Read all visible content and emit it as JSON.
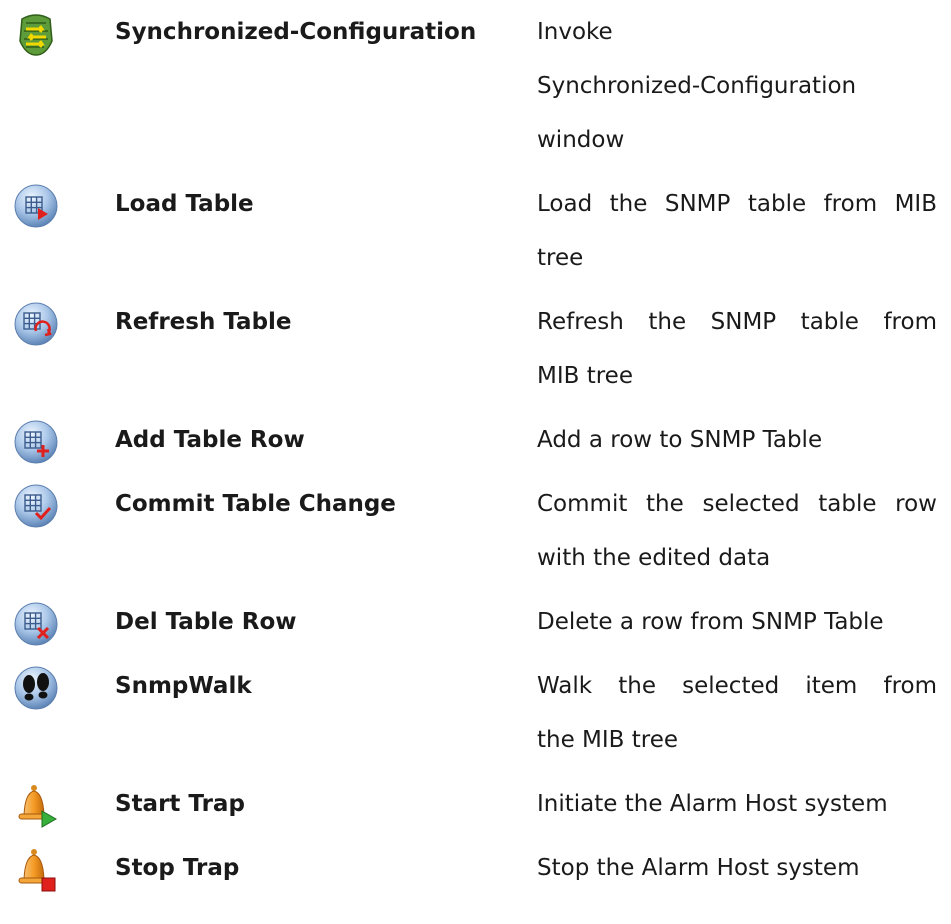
{
  "rows": [
    {
      "icon": "sync-config-icon",
      "name": "Synchronized-Configuration",
      "desc_lines": [
        "Invoke",
        "Synchronized-Configuration",
        "window"
      ]
    },
    {
      "icon": "load-table-icon",
      "name": "Load Table",
      "desc_lines": [
        "Load the SNMP table from MIB",
        "tree"
      ]
    },
    {
      "icon": "refresh-table-icon",
      "name": "Refresh Table",
      "desc_lines": [
        "Refresh the SNMP table from",
        "MIB tree"
      ]
    },
    {
      "icon": "add-table-row-icon",
      "name": "Add Table Row",
      "desc_lines": [
        "Add a row to SNMP Table"
      ]
    },
    {
      "icon": "commit-table-change-icon",
      "name": "Commit Table Change",
      "desc_lines": [
        "Commit the selected table row",
        "with the edited data"
      ]
    },
    {
      "icon": "del-table-row-icon",
      "name": "Del Table Row",
      "desc_lines": [
        "Delete a row from SNMP Table"
      ]
    },
    {
      "icon": "snmpwalk-icon",
      "name": "SnmpWalk",
      "desc_lines": [
        "Walk the selected item from",
        "the MIB tree"
      ]
    },
    {
      "icon": "start-trap-icon",
      "name": "Start Trap",
      "desc_lines": [
        "Initiate the Alarm Host system"
      ]
    },
    {
      "icon": "stop-trap-icon",
      "name": "Stop Trap",
      "desc_lines": [
        "Stop the Alarm Host system"
      ]
    }
  ]
}
